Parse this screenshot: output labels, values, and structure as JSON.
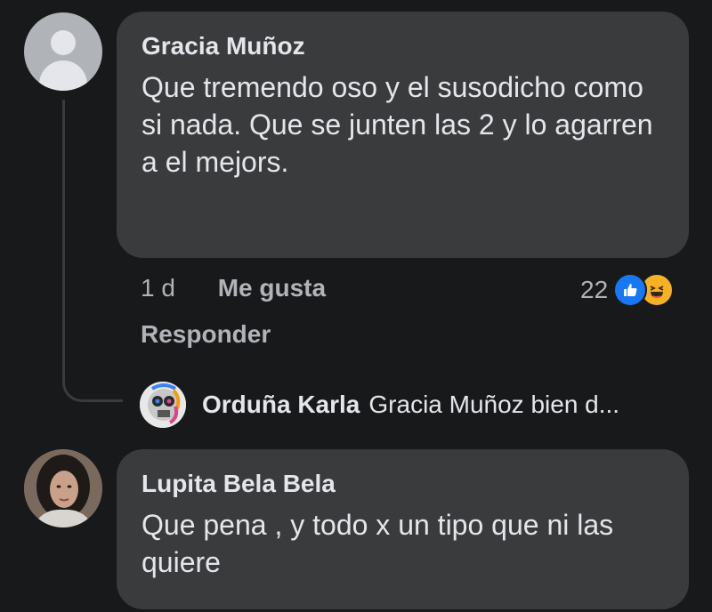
{
  "comments": [
    {
      "author": "Gracia Muñoz",
      "text": "Que tremendo oso y el susodicho como si nada. Que se junten las 2 y lo agarren a el mejors.",
      "time": "1 d",
      "like_label": "Me gusta",
      "reply_label": "Responder",
      "reaction_count": "22",
      "reactions": [
        "like-icon",
        "haha-icon"
      ],
      "avatar": "default-avatar-icon"
    },
    {
      "author": "Lupita Bela Bela",
      "text": "Que pena , y todo x un tipo que ni las quiere",
      "avatar": "user-photo"
    }
  ],
  "reply_preview": {
    "author": "Orduña Karla",
    "text": "Gracia Muñoz bien d...",
    "avatar": "user-photo"
  },
  "colors": {
    "background": "#18191a",
    "bubble": "#3a3b3c",
    "text_primary": "#e4e6eb",
    "text_secondary": "#b0b3b8",
    "like_blue": "#1877f2",
    "haha_yellow": "#f7b125"
  }
}
